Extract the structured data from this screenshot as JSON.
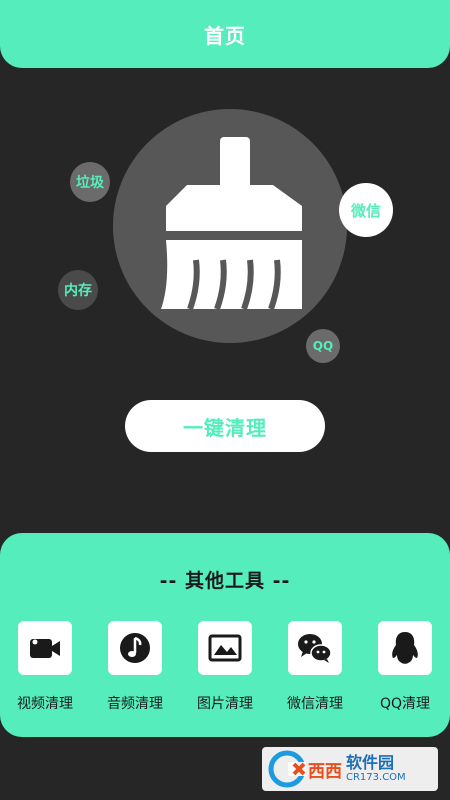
{
  "header": {
    "title": "首页"
  },
  "bubbles": {
    "trash": "垃圾",
    "wechat": "微信",
    "memory": "内存",
    "qq": "QQ"
  },
  "main": {
    "clean_button": "一键清理"
  },
  "tools": {
    "title": "-- 其他工具 --",
    "items": [
      {
        "label": "视频清理",
        "icon": "video-camera-icon"
      },
      {
        "label": "音频清理",
        "icon": "music-note-icon"
      },
      {
        "label": "图片清理",
        "icon": "picture-icon"
      },
      {
        "label": "微信清理",
        "icon": "wechat-icon"
      },
      {
        "label": "QQ清理",
        "icon": "qq-penguin-icon"
      }
    ]
  },
  "watermark": {
    "brand": "西西",
    "site": "软件园",
    "url": "CR173.COM"
  },
  "colors": {
    "accent": "#55edbc",
    "background": "#262626",
    "circle": "#575757"
  }
}
